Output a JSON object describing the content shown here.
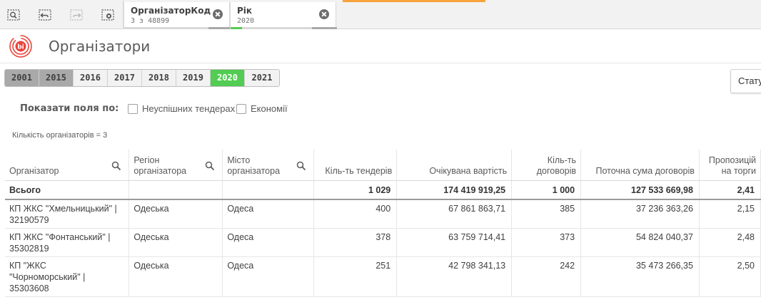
{
  "selection_bar": {
    "tools": [
      "smart-search-icon",
      "step-back-icon",
      "step-forward-icon",
      "clear-selections-icon"
    ],
    "chips": [
      {
        "title": "ОрганізаторКод",
        "value": "3 з 48899",
        "fill_fraction": 0.0
      },
      {
        "title": "Рік",
        "value": "2020",
        "fill_fraction": 0.11
      }
    ],
    "accent_color": "#f8a33c"
  },
  "header": {
    "logo_text": "bi",
    "title": "Організатори",
    "brand_color": "#e8453c"
  },
  "years": {
    "items": [
      {
        "label": "2001",
        "state": "excluded"
      },
      {
        "label": "2015",
        "state": "excluded"
      },
      {
        "label": "2016",
        "state": "possible"
      },
      {
        "label": "2017",
        "state": "possible"
      },
      {
        "label": "2018",
        "state": "possible"
      },
      {
        "label": "2019",
        "state": "possible"
      },
      {
        "label": "2020",
        "state": "selected"
      },
      {
        "label": "2021",
        "state": "possible"
      }
    ],
    "selected_color": "#52cc52",
    "excluded_color": "#a9a9a9"
  },
  "status_dropdown": {
    "label": "Стату"
  },
  "show_fields": {
    "label": "Показати поля по:",
    "options": [
      {
        "label": "Неуспішних тендерах",
        "checked": false
      },
      {
        "label": "Економії",
        "checked": false
      }
    ]
  },
  "count_text": "Кількість організаторів = 3",
  "table": {
    "columns": [
      {
        "label_lines": [
          "Організатор"
        ],
        "searchable": true,
        "align": "left"
      },
      {
        "label_lines": [
          "Регіон",
          "організатора"
        ],
        "searchable": true,
        "align": "left"
      },
      {
        "label_lines": [
          "Місто",
          "організатора"
        ],
        "searchable": true,
        "align": "left"
      },
      {
        "label_lines": [
          "Кіль-ть тендерів"
        ],
        "searchable": false,
        "align": "right",
        "sorted": true
      },
      {
        "label_lines": [
          "Очікувана вартість"
        ],
        "searchable": false,
        "align": "right"
      },
      {
        "label_lines": [
          "Кіль-ть",
          "договорів"
        ],
        "searchable": false,
        "align": "right"
      },
      {
        "label_lines": [
          "Поточна сума договорів"
        ],
        "searchable": false,
        "align": "right"
      },
      {
        "label_lines": [
          "Пропозицій",
          "на торги"
        ],
        "searchable": false,
        "align": "right"
      }
    ],
    "total": {
      "label": "Всього",
      "values": [
        "1 029",
        "174 419 919,25",
        "1 000",
        "127 533 669,98",
        "2,41"
      ]
    },
    "rows": [
      {
        "organizer_lines": [
          "КП ЖКС \"Хмельницький\" |",
          "32190579"
        ],
        "region": "Одеська",
        "city": "Одеса",
        "tenders": "400",
        "expected": "67 861 863,71",
        "contracts": "385",
        "sum": "37 236 363,26",
        "bids": "2,15"
      },
      {
        "organizer_lines": [
          "КП ЖКС \"Фонтанський\" |",
          "35302819"
        ],
        "region": "Одеська",
        "city": "Одеса",
        "tenders": "378",
        "expected": "63 759 714,41",
        "contracts": "373",
        "sum": "54 824 040,37",
        "bids": "2,48"
      },
      {
        "organizer_lines": [
          "КП \"ЖКС",
          "\"Чорноморський\" |",
          "35303608"
        ],
        "region": "Одеська",
        "city": "Одеса",
        "tenders": "251",
        "expected": "42 798 341,13",
        "contracts": "242",
        "sum": "35 473 266,35",
        "bids": "2,50"
      }
    ]
  }
}
